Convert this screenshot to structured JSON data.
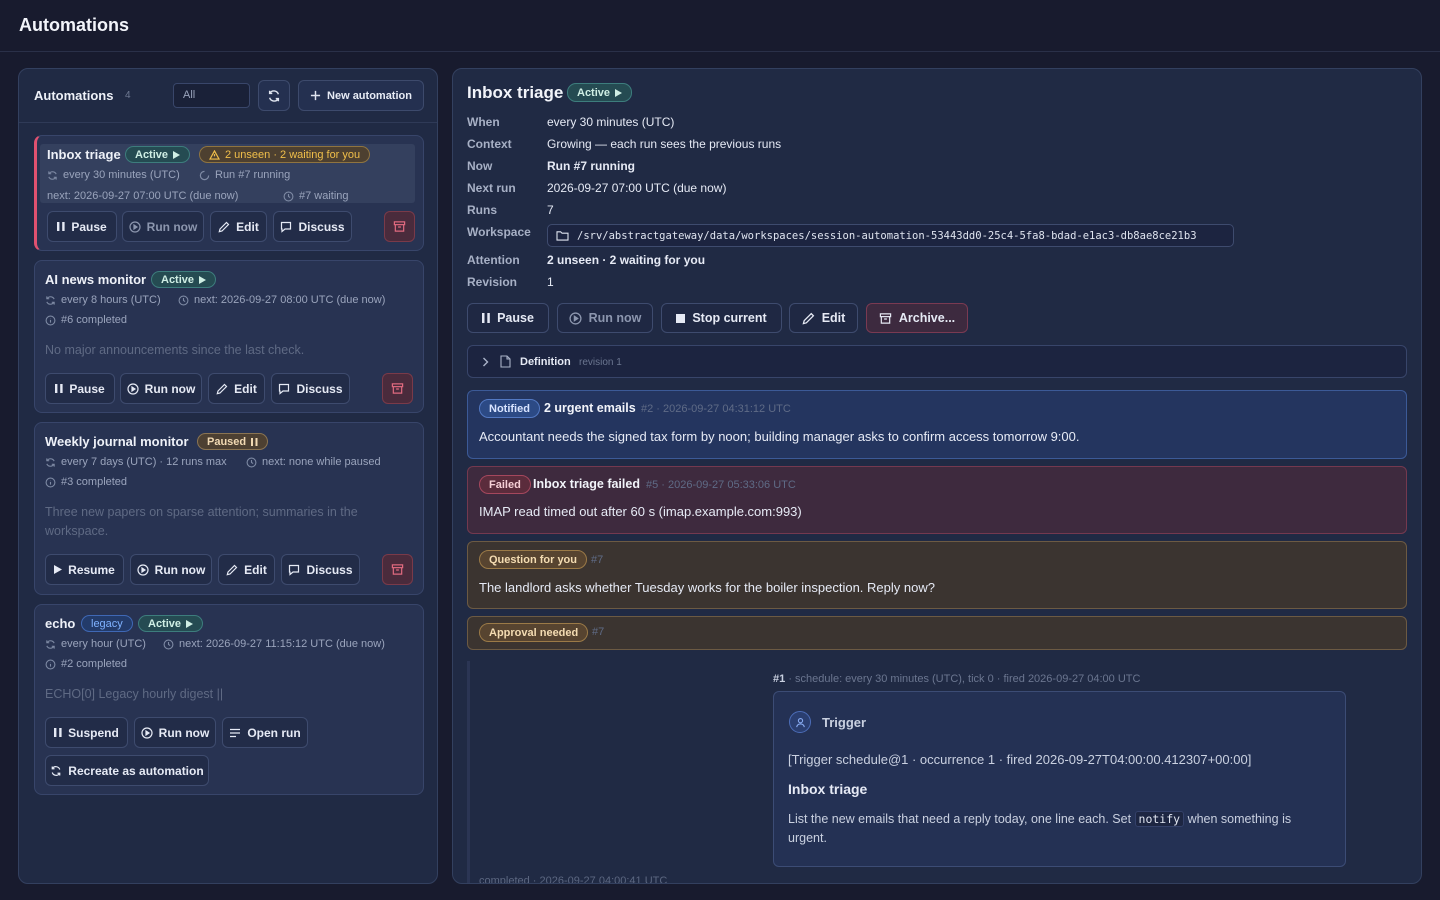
{
  "app": {
    "title": "Automations"
  },
  "list": {
    "title": "Automations",
    "count": "4",
    "filter_value": "All",
    "new_label": "New automation",
    "items": [
      {
        "name": "Inbox triage",
        "status": "Active",
        "attention": "2 unseen · 2 waiting for you",
        "schedule": "every 30 minutes (UTC)",
        "run": "Run #7 running",
        "next": "next: 2026-09-27 07:00 UTC (due now)",
        "waiting": "#7 waiting",
        "buttons": [
          "Pause",
          "Run now",
          "Edit",
          "Discuss"
        ]
      },
      {
        "name": "AI news monitor",
        "status": "Active",
        "schedule": "every 8 hours (UTC)",
        "next": "next: 2026-09-27 08:00 UTC (due now)",
        "last": "#6 completed",
        "summary": "No major announcements since the last check.",
        "buttons": [
          "Pause",
          "Run now",
          "Edit",
          "Discuss"
        ]
      },
      {
        "name": "Weekly journal monitor",
        "status": "Paused",
        "schedule": "every 7 days (UTC) · 12 runs max",
        "next": "next: none while paused",
        "last": "#3 completed",
        "summary": "Three new papers on sparse attention; summaries in the workspace.",
        "buttons": [
          "Resume",
          "Run now",
          "Edit",
          "Discuss"
        ]
      },
      {
        "name": "echo",
        "legacy": "legacy",
        "status": "Active",
        "schedule": "every hour (UTC)",
        "next": "next: 2026-09-27 11:15:12 UTC (due now)",
        "last": "#2 completed",
        "summary": "ECHO[0] Legacy hourly digest ||",
        "buttons": [
          "Suspend",
          "Run now",
          "Open run",
          "Recreate as automation"
        ]
      }
    ]
  },
  "detail": {
    "title": "Inbox triage",
    "status": "Active",
    "fields": [
      {
        "key": "When",
        "value": "every 30 minutes (UTC)"
      },
      {
        "key": "Context",
        "value": "Growing — each run sees the previous runs"
      },
      {
        "key": "Now",
        "value": "Run #7 running"
      },
      {
        "key": "Next run",
        "value": "2026-09-27 07:00 UTC (due now)"
      },
      {
        "key": "Runs",
        "value": "7"
      },
      {
        "key": "Workspace",
        "value": "/srv/abstractgateway/data/workspaces/session-automation-53443dd0-25c4-5fa8-bdad-e1ac3-db8ae8ce21b3"
      },
      {
        "key": "Attention",
        "value": "2 unseen · 2 waiting for you"
      },
      {
        "key": "Revision",
        "value": "1"
      }
    ],
    "buttons": {
      "pause": "Pause",
      "run_now": "Run now",
      "stop": "Stop current",
      "edit": "Edit",
      "archive": "Archive..."
    },
    "definition": {
      "label": "Definition",
      "revision": "revision 1"
    },
    "notices": [
      {
        "tag": "Notified",
        "title": "2 urgent emails",
        "meta": "#2 · 2026-09-27 04:31:12 UTC",
        "body": "Accountant needs the signed tax form by noon; building manager asks to confirm access tomorrow 9:00."
      },
      {
        "tag": "Failed",
        "title": "Inbox triage failed",
        "meta": "#5 · 2026-09-27 05:33:06 UTC",
        "body": "IMAP read timed out after 60 s (imap.example.com:993)"
      },
      {
        "tag": "Question for you",
        "meta": "#7",
        "body": "The landlord asks whether Tuesday works for the boiler inspection. Reply now?"
      },
      {
        "tag": "Approval needed",
        "meta": "#7"
      }
    ],
    "run": {
      "id": "#1",
      "meta": "· schedule: every 30 minutes (UTC), tick 0 · fired 2026-09-27 04:00 UTC",
      "trigger_label": "Trigger",
      "trigger_line": "[Trigger schedule@1 · occurrence 1 · fired 2026-09-27T04:00:00.412307+00:00]",
      "heading": "Inbox triage",
      "text_a": "List the new emails that need a reply today, one line each. Set",
      "code": "notify",
      "text_b": "when something",
      "text_c": "is urgent.",
      "footer": "completed · 2026-09-27 04:00:41 UTC"
    }
  },
  "colors": {
    "accent_red": "#e05170",
    "active_green": "#3d7d7d",
    "warning": "#f1bf4a",
    "notice_blue": "#3c5a97"
  }
}
